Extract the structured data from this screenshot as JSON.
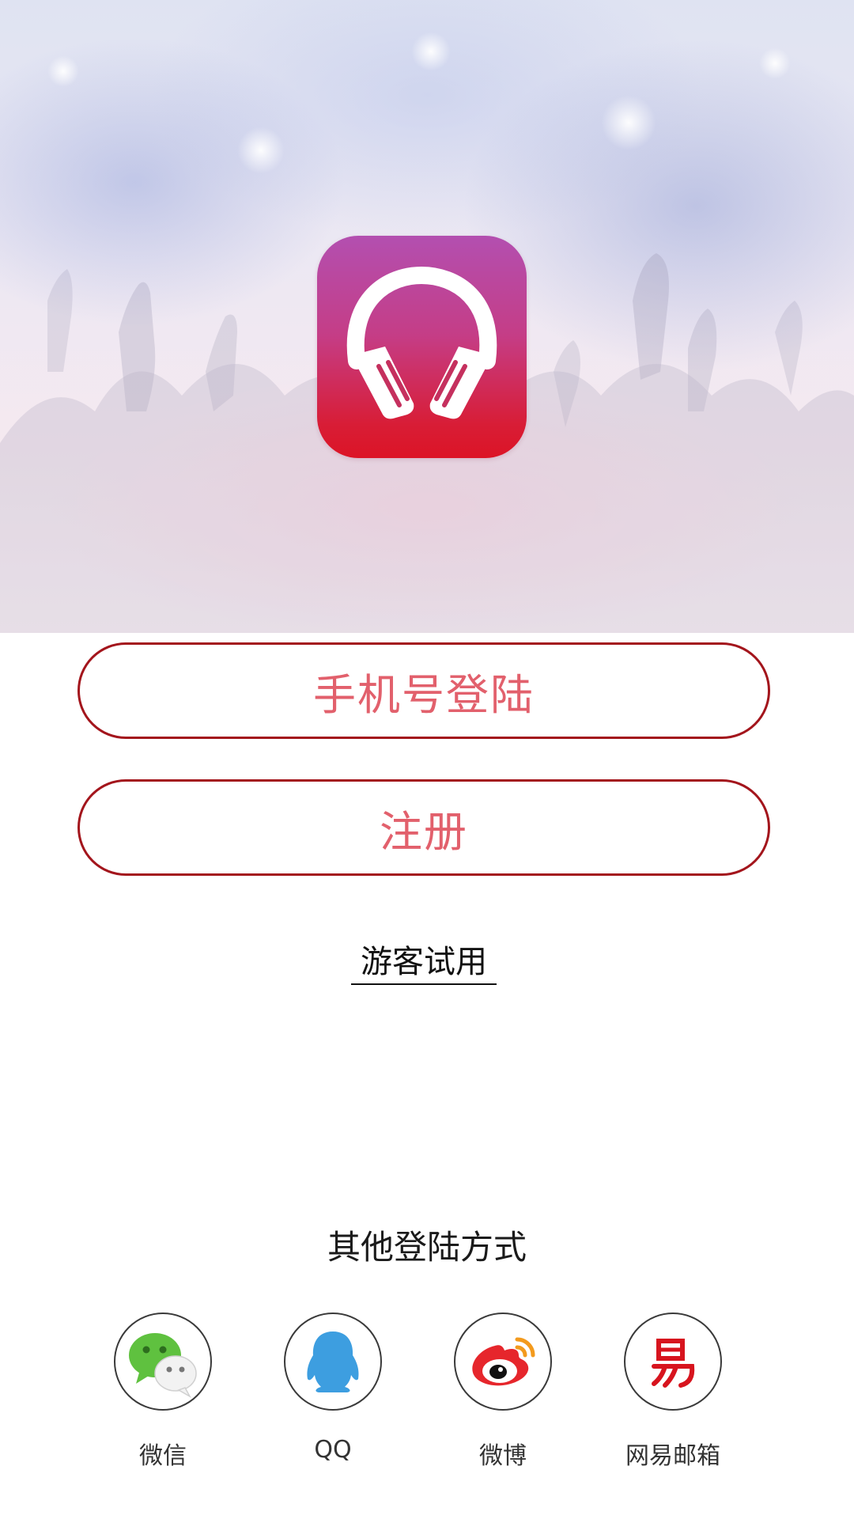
{
  "hero": {
    "app_icon": "headphones-icon",
    "icon_gradient": [
      "#b34fb0",
      "#dc1426"
    ]
  },
  "buttons": {
    "phone_login": "手机号登陆",
    "register": "注册"
  },
  "guest": {
    "label": "游客试用"
  },
  "other_login": {
    "title": "其他登陆方式",
    "options": [
      {
        "label": "微信",
        "icon": "wechat-icon"
      },
      {
        "label": "QQ",
        "icon": "qq-icon"
      },
      {
        "label": "微博",
        "icon": "weibo-icon"
      },
      {
        "label": "网易邮箱",
        "icon": "netease-mail-icon"
      }
    ]
  },
  "colors": {
    "accent_border": "#a3151c",
    "accent_text": "#e2606c"
  }
}
